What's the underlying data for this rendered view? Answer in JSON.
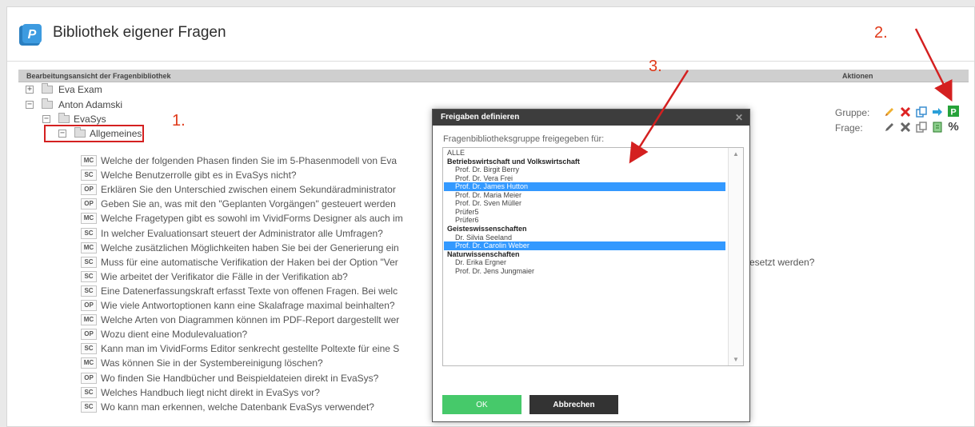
{
  "page": {
    "title": "Bibliothek eigener Fragen",
    "section_left": "Bearbeitungsansicht der Fragenbibliothek",
    "section_right": "Aktionen"
  },
  "tree": {
    "eva_exam": "Eva Exam",
    "anton": "Anton Adamski",
    "evasys": "EvaSys",
    "allgemeines": "Allgemeines",
    "questions": [
      {
        "type": "MC",
        "text": "Welche der folgenden Phasen finden Sie im 5-Phasenmodell von Eva"
      },
      {
        "type": "SC",
        "text": "Welche Benutzerrolle gibt es in EvaSys nicht?"
      },
      {
        "type": "OP",
        "text": "Erklären Sie den Unterschied zwischen einem Sekundäradministrator"
      },
      {
        "type": "OP",
        "text": "Geben Sie an, was mit den \"Geplanten Vorgängen\" gesteuert werden"
      },
      {
        "type": "MC",
        "text": "Welche Fragetypen gibt es sowohl im VividForms Designer als auch im"
      },
      {
        "type": "SC",
        "text": "In welcher Evaluationsart steuert der Administrator alle Umfragen?"
      },
      {
        "type": "MC",
        "text": "Welche zusätzlichen Möglichkeiten haben Sie bei der Generierung ein"
      },
      {
        "type": "SC",
        "text": "Muss für eine automatische Verifikation der Haken bei der Option \"Ver"
      },
      {
        "type": "SC",
        "text": "Wie arbeitet der Verifikator die Fälle in der Verifikation ab?"
      },
      {
        "type": "SC",
        "text": "Eine Datenerfassungskraft erfasst Texte von offenen Fragen. Bei welc"
      },
      {
        "type": "OP",
        "text": "Wie viele Antwortoptionen kann eine Skalafrage maximal beinhalten?"
      },
      {
        "type": "MC",
        "text": "Welche Arten von Diagrammen können im PDF-Report dargestellt wer"
      },
      {
        "type": "OP",
        "text": "Wozu dient eine Modulevaluation?"
      },
      {
        "type": "SC",
        "text": "Kann man im VividForms Editor senkrecht gestellte Poltexte für eine S"
      },
      {
        "type": "MC",
        "text": "Was können Sie in der Systembereinigung löschen?"
      },
      {
        "type": "OP",
        "text": "Wo finden Sie Handbücher und Beispieldateien direkt in EvaSys?"
      },
      {
        "type": "SC",
        "text": "Welches Handbuch liegt nicht direkt in EvaSys vor?"
      },
      {
        "type": "SC",
        "text": "Wo kann man erkennen, welche Datenbank EvaSys verwendet?"
      }
    ],
    "trailing_text": "esetzt werden?"
  },
  "actions": {
    "gruppe_label": "Gruppe:",
    "frage_label": "Frage:",
    "percent": "%"
  },
  "annotations": {
    "step1": "1.",
    "step2": "2.",
    "step3": "3."
  },
  "dialog": {
    "title": "Freigaben definieren",
    "caption": "Fragenbibliotheksgruppe freigegeben für:",
    "items": [
      {
        "label": "ALLE",
        "kind": "all",
        "selected": false
      },
      {
        "label": "Betriebswirtschaft und Volkswirtschaft",
        "kind": "group",
        "selected": false
      },
      {
        "label": "Prof. Dr. Birgit Berry",
        "kind": "item",
        "selected": false
      },
      {
        "label": "Prof. Dr. Vera Frei",
        "kind": "item",
        "selected": false
      },
      {
        "label": "Prof. Dr. James Hutton",
        "kind": "item",
        "selected": true
      },
      {
        "label": "Prof. Dr. Maria Meier",
        "kind": "item",
        "selected": false
      },
      {
        "label": "Prof. Dr. Sven Müller",
        "kind": "item",
        "selected": false
      },
      {
        "label": "Prüfer5",
        "kind": "item",
        "selected": false
      },
      {
        "label": "Prüfer6",
        "kind": "item",
        "selected": false
      },
      {
        "label": "Geisteswissenschaften",
        "kind": "group",
        "selected": false
      },
      {
        "label": "Dr. Silvia Seeland",
        "kind": "item",
        "selected": false
      },
      {
        "label": "Prof. Dr. Carolin Weber",
        "kind": "item",
        "selected": true
      },
      {
        "label": "Naturwissenschaften",
        "kind": "group",
        "selected": false
      },
      {
        "label": "Dr. Erika Ergner",
        "kind": "item",
        "selected": false
      },
      {
        "label": "Prof. Dr. Jens Jungmaier",
        "kind": "item",
        "selected": false
      }
    ],
    "ok_label": "OK",
    "cancel_label": "Abbrechen"
  },
  "colors": {
    "accent_red": "#d42020",
    "selection_blue": "#3399ff",
    "ok_green": "#46c96a",
    "dialog_header": "#3d3d3d"
  }
}
